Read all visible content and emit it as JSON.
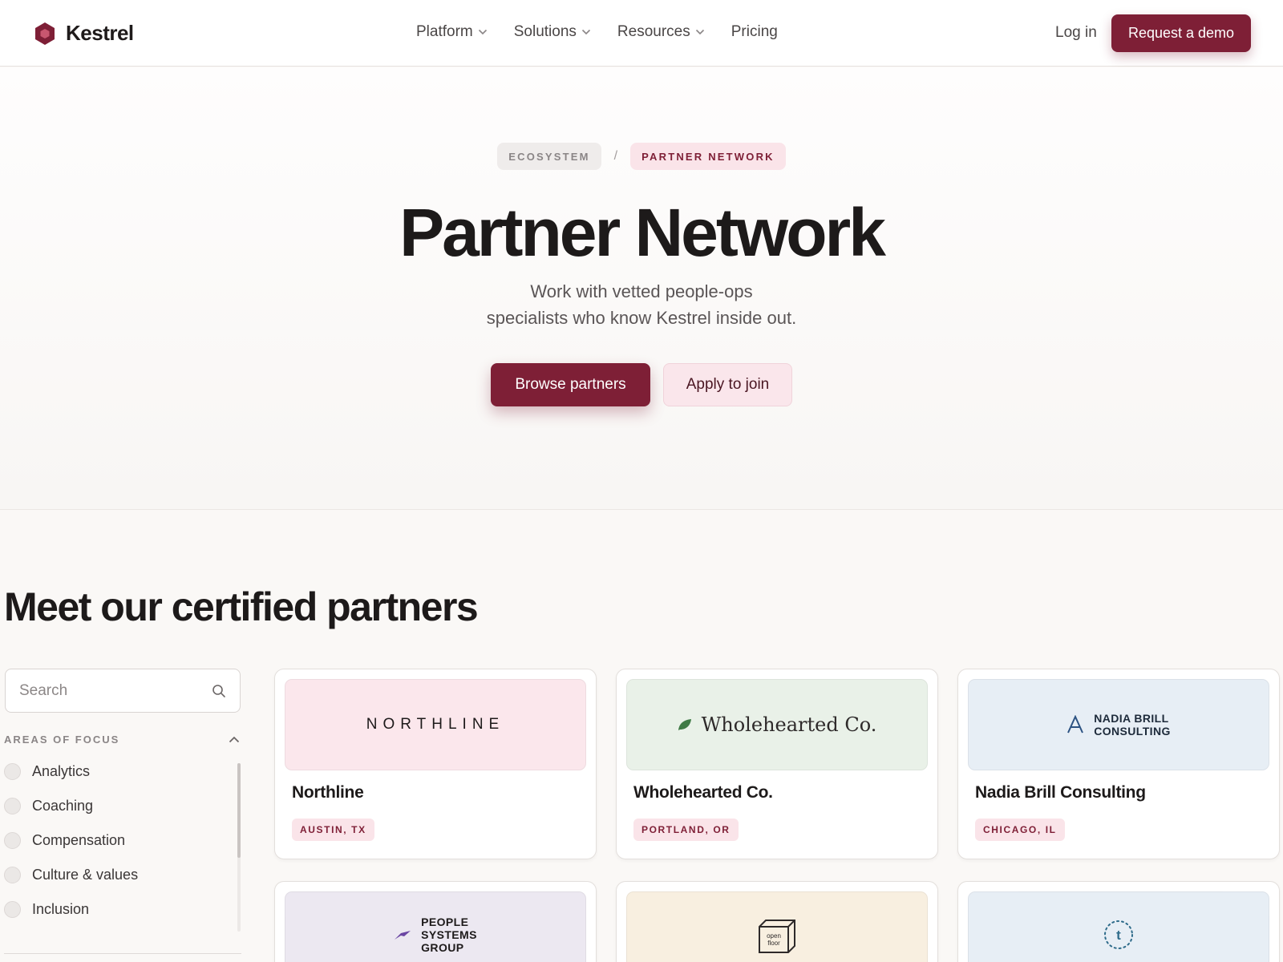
{
  "brand": {
    "name": "Kestrel",
    "logo_icon": "hexagon-logo-icon",
    "color": "#7e1f36"
  },
  "nav": {
    "items": [
      {
        "label": "Platform",
        "has_dropdown": true
      },
      {
        "label": "Solutions",
        "has_dropdown": true
      },
      {
        "label": "Resources",
        "has_dropdown": true
      },
      {
        "label": "Pricing",
        "has_dropdown": false
      }
    ],
    "login_label": "Log in",
    "demo_label": "Request a demo"
  },
  "hero": {
    "breadcrumb": [
      "ECOSYSTEM",
      "PARTNER NETWORK"
    ],
    "breadcrumb_separator": "/",
    "title": "Partner Network",
    "subtitle_line1": "Work with vetted people-ops",
    "subtitle_line2": "specialists who know Kestrel inside out.",
    "primary_button": "Browse partners",
    "secondary_button": "Apply to join"
  },
  "partners": {
    "heading": "Meet our certified partners",
    "search_placeholder": "Search",
    "filter_title": "AREAS OF FOCUS",
    "filter_options": [
      "Analytics",
      "Coaching",
      "Compensation",
      "Culture & values",
      "Inclusion"
    ],
    "cards": [
      {
        "name": "Northline",
        "location": "AUSTIN, TX",
        "logo_text": "NORTHLINE",
        "logo_bg": "#fbe7ec"
      },
      {
        "name": "Wholehearted Co.",
        "location": "PORTLAND, OR",
        "logo_text": "Wholehearted Co.",
        "logo_icon": "leaf-icon",
        "logo_bg": "#e9f1e8"
      },
      {
        "name": "Nadia Brill Consulting",
        "location": "CHICAGO, IL",
        "logo_line1": "NADIA BRILL",
        "logo_line2": "CONSULTING",
        "logo_icon": "letter-a-icon",
        "logo_bg": "#e7eef5"
      },
      {
        "logo_line1": "PEOPLE",
        "logo_line2": "SYSTEMS",
        "logo_line3": "GROUP",
        "logo_icon": "bird-icon",
        "logo_bg": "#ece8f1"
      },
      {
        "logo_line1": "open",
        "logo_line2": "floor",
        "logo_icon": "box-icon",
        "logo_bg": "#f8efe0"
      },
      {
        "logo_text": "t",
        "logo_icon": "dotted-circle-icon",
        "logo_bg": "#e7eef5"
      }
    ]
  }
}
